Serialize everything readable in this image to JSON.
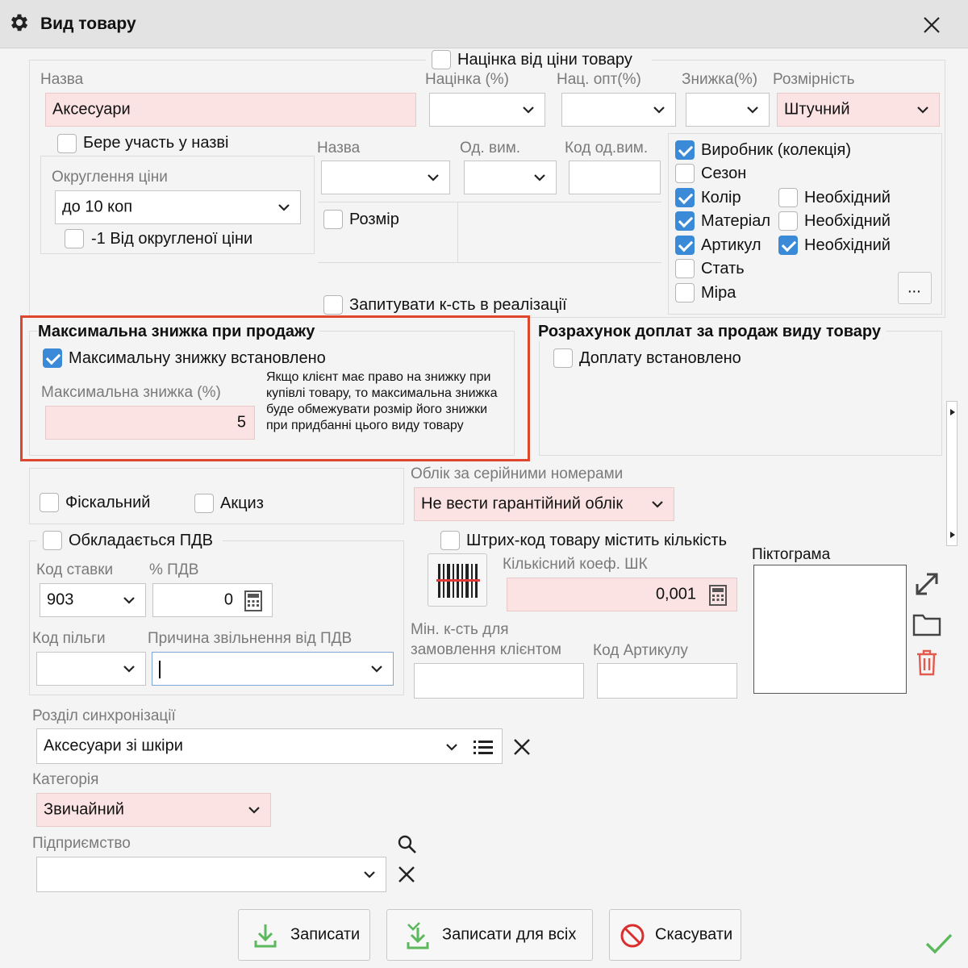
{
  "window": {
    "title": "Вид товару"
  },
  "markup": {
    "checkbox_label": "Націнка від ціни товару",
    "markup_label": "Націнка (%)",
    "wholesale_label": "Нац. опт(%)",
    "discount_label": "Знижка(%)",
    "dimension_label": "Розмірність",
    "dimension_value": "Штучний"
  },
  "name": {
    "label": "Назва",
    "value": "Аксесуари",
    "participates_label": "Бере участь у назві"
  },
  "rounding": {
    "label": "Округлення ціни",
    "value": "до 10 коп",
    "minus_one_label": "-1 Від округленої ціни"
  },
  "unit": {
    "name_label": "Назва",
    "unit_label": "Од. вим.",
    "code_label": "Код од.вим.",
    "size_label": "Розмір",
    "ask_qty_label": "Запитувати к-сть в реалізації"
  },
  "attributes": {
    "items": [
      {
        "label": "Виробник (колекція)",
        "checked": true
      },
      {
        "label": "Сезон",
        "checked": false
      },
      {
        "label": "Колір",
        "checked": true,
        "required_label": "Необхідний",
        "required": false
      },
      {
        "label": "Матеріал",
        "checked": true,
        "required_label": "Необхідний",
        "required": false
      },
      {
        "label": "Артикул",
        "checked": true,
        "required_label": "Необхідний",
        "required": true
      },
      {
        "label": "Стать",
        "checked": false
      },
      {
        "label": "Міра",
        "checked": false
      }
    ],
    "more_label": "..."
  },
  "max_discount": {
    "heading": "Максимальна знижка при продажу",
    "set_label": "Максимальну знижку встановлено",
    "field_label": "Максимальна знижка (%)",
    "value": "5",
    "note": "Якщо клієнт має право на знижку при купівлі товару, то максимальна знижка буде обмежувати розмір його знижки при придбанні цього виду товару"
  },
  "surcharge": {
    "heading": "Розрахунок доплат за продаж виду товару",
    "set_label": "Доплату встановлено"
  },
  "fiscal": {
    "fiscal_label": "Фіскальний",
    "excise_label": "Акциз"
  },
  "serial": {
    "label": "Облік за серійними номерами",
    "value": "Не вести гарантійний облік"
  },
  "vat": {
    "taxed_label": "Обкладається ПДВ",
    "rate_code_label": "Код ставки",
    "rate_code_value": "903",
    "percent_label": "% ПДВ",
    "percent_value": "0",
    "benefit_label": "Код пільги",
    "reason_label": "Причина звільнення від ПДВ"
  },
  "barcode": {
    "contains_qty_label": "Штрих-код товару містить кількість",
    "coef_label": "Кількісний коеф. ШК",
    "coef_value": "0,001",
    "min_qty_label_1": "Мін. к-сть для",
    "min_qty_label_2": "замовлення клієнтом",
    "article_code_label": "Код Артикулу"
  },
  "pictogram": {
    "label": "Піктограма"
  },
  "sync": {
    "label": "Розділ синхронізації",
    "value": "Аксесуари зі шкіри"
  },
  "category": {
    "label": "Категорія",
    "value": "Звичайний"
  },
  "enterprise": {
    "label": "Підприємство"
  },
  "buttons": {
    "save": "Записати",
    "save_all": "Записати для всіх",
    "cancel": "Скасувати"
  },
  "colors": {
    "accent": "#3b8ad8",
    "required_field": "#fbe3e3",
    "highlight": "#e0452d",
    "save_icon": "#5cb85c",
    "cancel_icon": "#d9302f"
  }
}
